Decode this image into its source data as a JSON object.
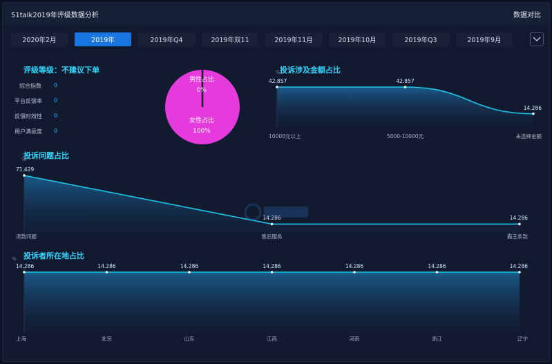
{
  "header": {
    "title": "51talk2019年评级数据分析",
    "compare_label": "数据对比"
  },
  "tabs": [
    {
      "label": "2020年2月",
      "active": false
    },
    {
      "label": "2019年",
      "active": true
    },
    {
      "label": "2019年Q4",
      "active": false
    },
    {
      "label": "2019年双11",
      "active": false
    },
    {
      "label": "2019年11月",
      "active": false
    },
    {
      "label": "2019年10月",
      "active": false
    },
    {
      "label": "2019年Q3",
      "active": false
    },
    {
      "label": "2019年9月",
      "active": false
    }
  ],
  "rating": {
    "title": "评级等级：不建议下单",
    "metrics": [
      {
        "label": "综合指数",
        "value": "0"
      },
      {
        "label": "平台反馈率",
        "value": "0"
      },
      {
        "label": "反馈时效性",
        "value": "0"
      },
      {
        "label": "用户满意度",
        "value": "0"
      }
    ]
  },
  "gender_pie": {
    "male_label": "男性占比",
    "male_value": "0%",
    "female_label": "女性占比",
    "female_value": "100%",
    "male_fraction": 0,
    "female_fraction": 1,
    "colors": {
      "female": "#e53adc",
      "male": "#1b1f33"
    }
  },
  "chart_data": [
    {
      "id": "amount",
      "type": "area",
      "title": "投诉涉及金额占比",
      "ylabel": "%",
      "categories": [
        "10000元以上",
        "5000-10000元",
        "未选择金额"
      ],
      "values": [
        42.857,
        42.857,
        14.286
      ],
      "value_labels": [
        "42.857",
        "42.857",
        "14.286"
      ]
    },
    {
      "id": "issue",
      "type": "area",
      "title": "投诉问题占比",
      "ylabel": "%",
      "categories": [
        "退款问题",
        "售后服务",
        "霸王条款"
      ],
      "values": [
        71.429,
        14.286,
        14.286
      ],
      "value_labels": [
        "71.429",
        "14.286",
        "14.286"
      ]
    },
    {
      "id": "region",
      "type": "area",
      "title": "投诉者所在地占比",
      "ylabel": "%",
      "categories": [
        "上海",
        "北京",
        "山东",
        "江西",
        "河南",
        "浙江",
        "辽宁"
      ],
      "values": [
        14.286,
        14.286,
        14.286,
        14.286,
        14.286,
        14.286,
        14.286
      ],
      "value_labels": [
        "14.286",
        "14.286",
        "14.286",
        "14.286",
        "14.286",
        "14.286",
        "14.286"
      ]
    }
  ],
  "colors": {
    "accent": "#35d6ff",
    "line": "#1fc6e8",
    "active_tab": "#1976e0"
  }
}
